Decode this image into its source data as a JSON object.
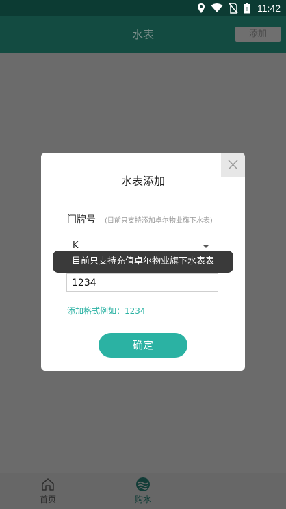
{
  "status_bar": {
    "time": "11:42",
    "icons": [
      "location-icon",
      "wifi-icon",
      "no-sim-icon",
      "battery-icon"
    ]
  },
  "app_bar": {
    "title": "水表",
    "add_label": "添加"
  },
  "dialog": {
    "title": "水表添加",
    "door_label": "门牌号",
    "door_hint": "(目前只支持添加卓尔物业旗下水表)",
    "select_value": "K",
    "input_value": "1234",
    "example": "添加格式例如：1234",
    "confirm_label": "确定"
  },
  "toast": {
    "text": "目前只支持充值卓尔物业旗下水表表"
  },
  "bottom_nav": {
    "items": [
      {
        "label": "首页",
        "icon": "home-icon"
      },
      {
        "label": "购水",
        "icon": "water-icon"
      }
    ]
  },
  "colors": {
    "accent": "#2bb2a3",
    "app_bar_dimmed": "#134b41",
    "overlay": "#6b6b6b"
  }
}
